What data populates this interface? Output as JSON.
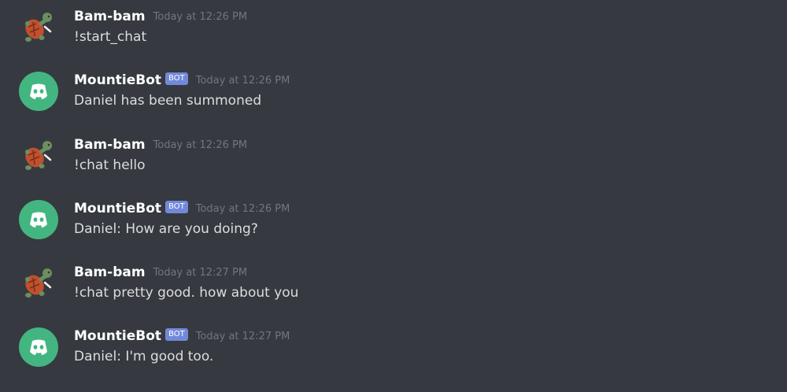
{
  "messages": [
    {
      "author": "Bam-bam",
      "timestamp": "Today at 12:26 PM",
      "content": "!start_chat",
      "avatar_icon": "turtle-icon"
    },
    {
      "author": "MountieBot",
      "badge": "BOT",
      "timestamp": "Today at 12:26 PM",
      "content": "Daniel has been summoned",
      "avatar_icon": "discord-logo-icon"
    },
    {
      "author": "Bam-bam",
      "timestamp": "Today at 12:26 PM",
      "content": "!chat hello",
      "avatar_icon": "turtle-icon"
    },
    {
      "author": "MountieBot",
      "badge": "BOT",
      "timestamp": "Today at 12:26 PM",
      "content": "Daniel: How are you doing?",
      "avatar_icon": "discord-logo-icon"
    },
    {
      "author": "Bam-bam",
      "timestamp": "Today at 12:27 PM",
      "content": "!chat pretty good. how about you",
      "avatar_icon": "turtle-icon"
    },
    {
      "author": "MountieBot",
      "badge": "BOT",
      "timestamp": "Today at 12:27 PM",
      "content": "Daniel: I'm good too.",
      "avatar_icon": "discord-logo-icon"
    }
  ],
  "colors": {
    "background": "#36393f",
    "username": "#ffffff",
    "message_text": "#dcddde",
    "timestamp": "#72767d",
    "bot_badge": "#7289da",
    "bot_avatar": "#43b581"
  }
}
